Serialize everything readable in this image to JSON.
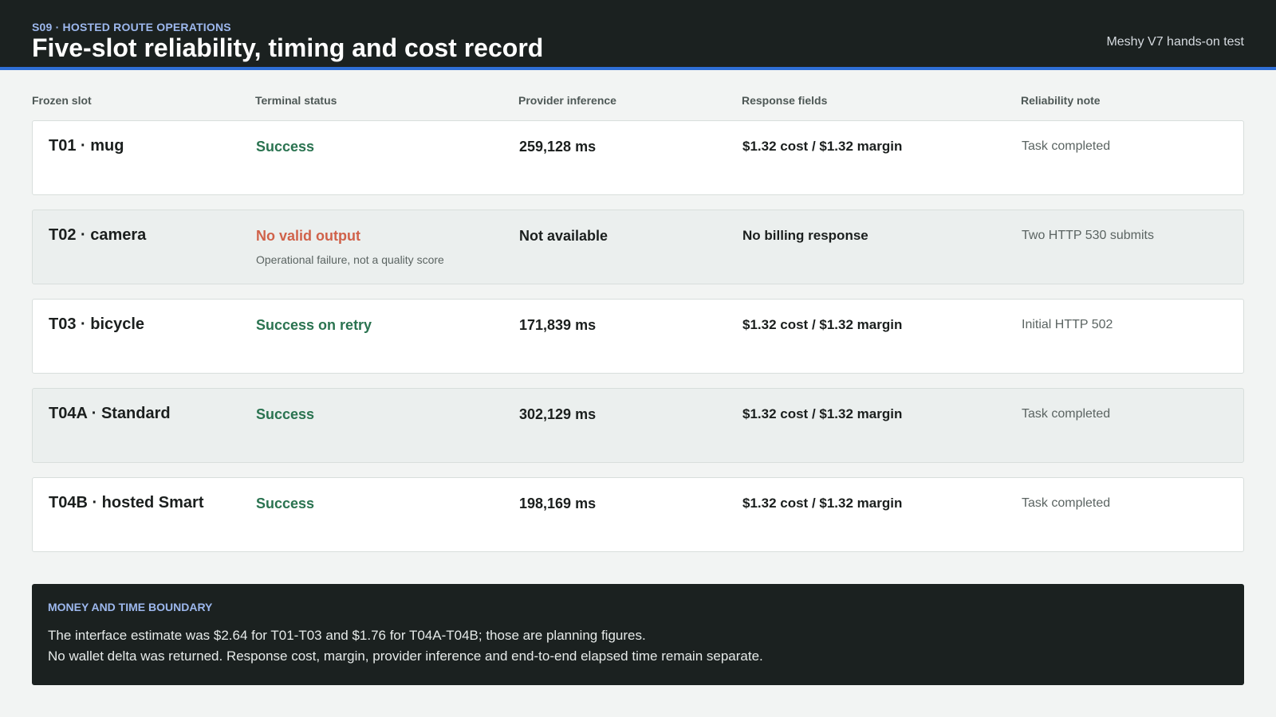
{
  "header": {
    "eyebrow": "S09 · HOSTED ROUTE OPERATIONS",
    "title": "Five-slot reliability, timing and cost record",
    "meta": "Meshy V7 hands-on test"
  },
  "colors": {
    "header_bg": "#1b2120",
    "accent_rule": "#2f6fd6",
    "success": "#2a7350",
    "failure": "#d0624a"
  },
  "table": {
    "columns": [
      "Frozen slot",
      "Terminal status",
      "Provider inference",
      "Response fields",
      "Reliability note"
    ],
    "rows": [
      {
        "slot": "T01 · mug",
        "status": "Success",
        "status_kind": "success",
        "sub": "",
        "inference": "259,128 ms",
        "response": "$1.32 cost / $1.32 margin",
        "note": "Task completed"
      },
      {
        "slot": "T02 · camera",
        "status": "No valid output",
        "status_kind": "failure",
        "sub": "Operational failure, not a quality score",
        "inference": "Not available",
        "response": "No billing response",
        "note": "Two HTTP 530 submits"
      },
      {
        "slot": "T03 · bicycle",
        "status": "Success on retry",
        "status_kind": "success",
        "sub": "",
        "inference": "171,839 ms",
        "response": "$1.32 cost / $1.32 margin",
        "note": "Initial HTTP 502"
      },
      {
        "slot": "T04A · Standard",
        "status": "Success",
        "status_kind": "success",
        "sub": "",
        "inference": "302,129 ms",
        "response": "$1.32 cost / $1.32 margin",
        "note": "Task completed"
      },
      {
        "slot": "T04B · hosted Smart",
        "status": "Success",
        "status_kind": "success",
        "sub": "",
        "inference": "198,169 ms",
        "response": "$1.32 cost / $1.32 margin",
        "note": "Task completed"
      }
    ]
  },
  "boundary": {
    "title": "MONEY AND TIME BOUNDARY",
    "line1": "The interface estimate was $2.64 for T01-T03 and $1.76 for T04A-T04B; those are planning figures.",
    "line2": "No wallet delta was returned. Response cost, margin, provider inference and end-to-end elapsed time remain separate."
  }
}
